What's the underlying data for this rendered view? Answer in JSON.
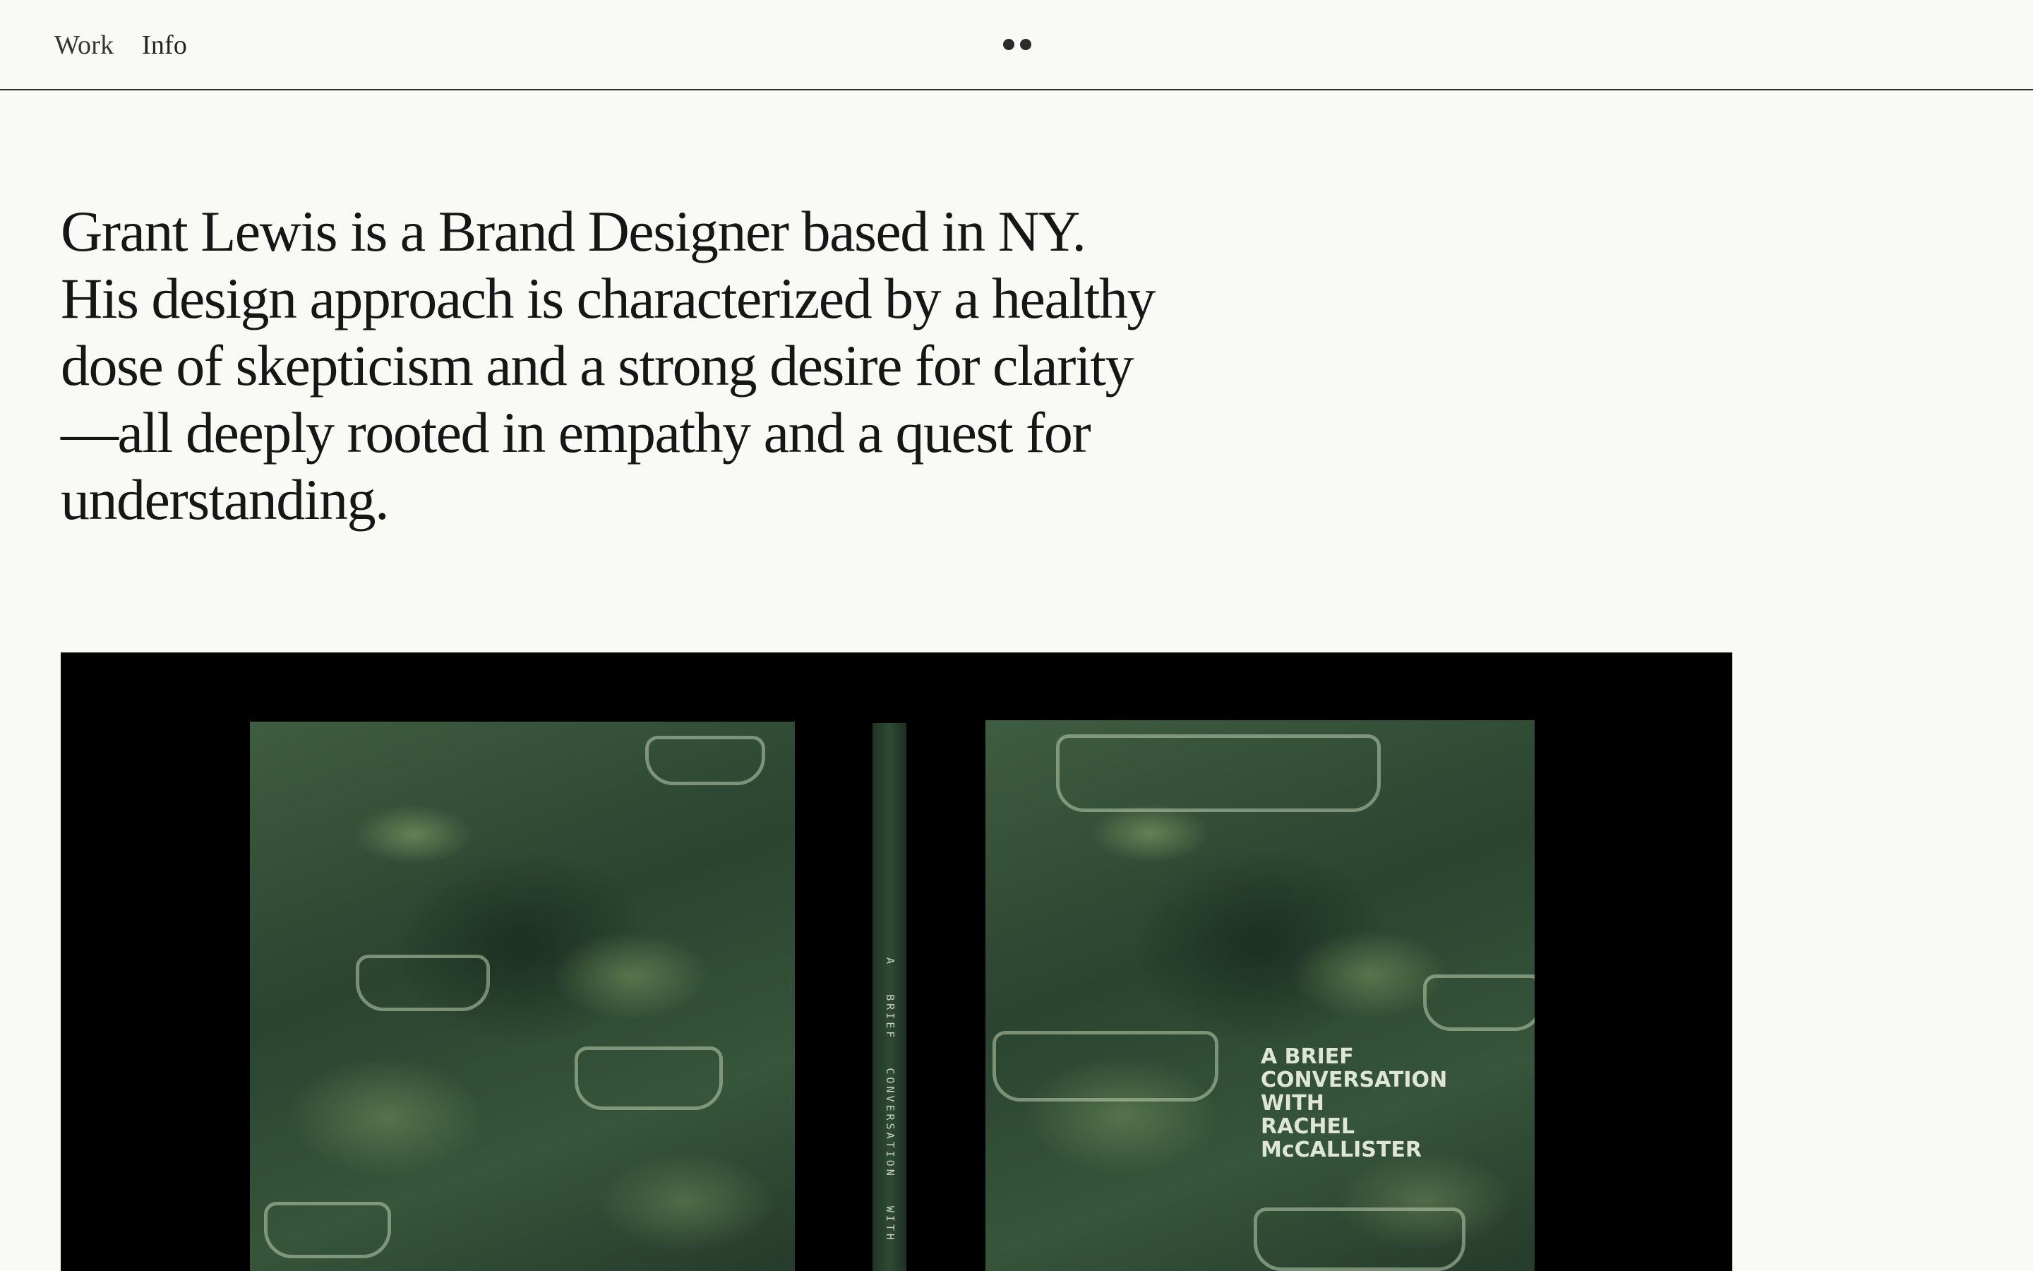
{
  "nav": {
    "work_label": "Work",
    "info_label": "Info"
  },
  "logo": {
    "icon": "two-dots-logo-icon"
  },
  "intro": {
    "text": "Grant Lewis is a Brand Designer based in NY. His design approach is characterized by a healthy dose of skepticism and a strong desire for clarity—all deeply rooted in empathy and a quest for understanding."
  },
  "hero": {
    "cover_title": "A BRIEF\nCONVERSATION\nWITH\nRACHEL\nMcCALLISTER",
    "spine_text": "A   BRIEF   CONVERSATION   WITH   RACHEL"
  },
  "colors": {
    "background": "#f9faf5",
    "text": "#161616",
    "hero_background": "#000000",
    "cover_green": "#2a4430"
  }
}
